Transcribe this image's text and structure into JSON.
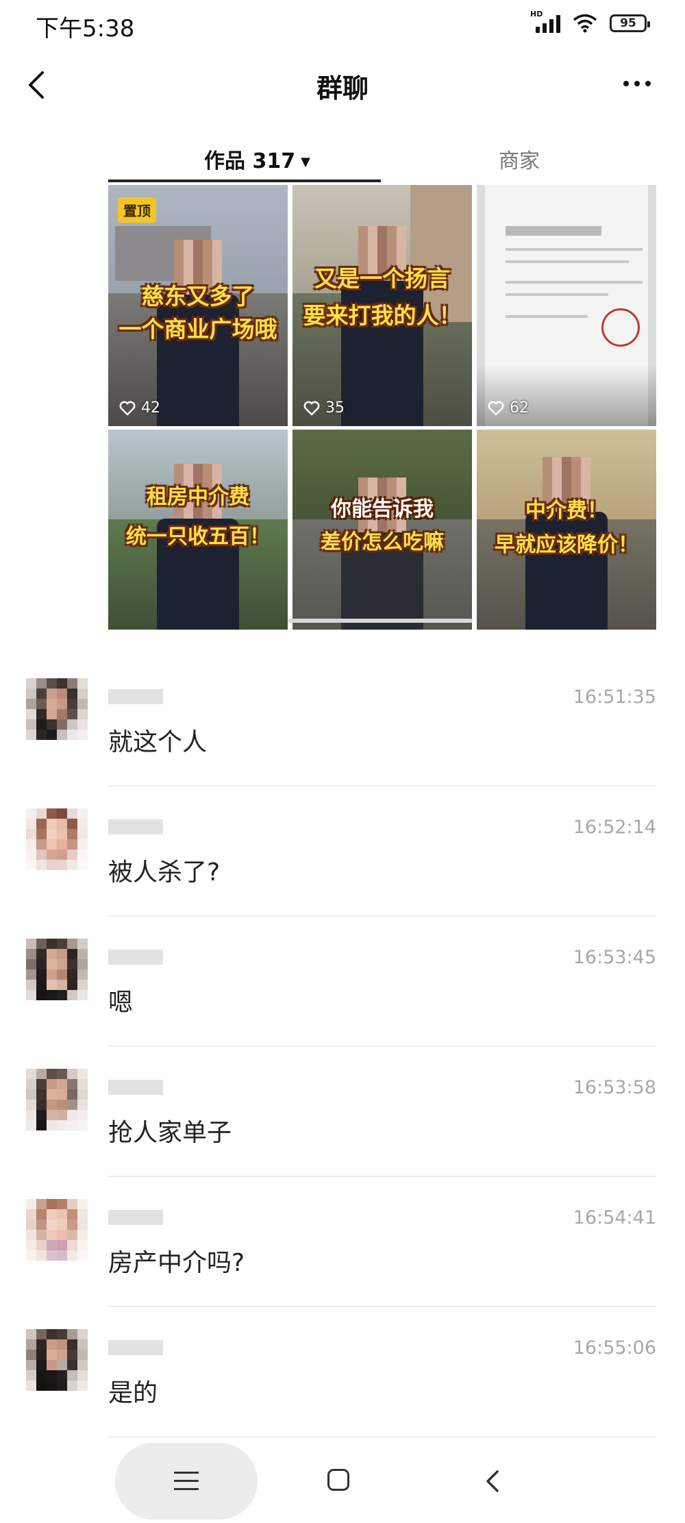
{
  "status": {
    "time": "下午5:38",
    "battery": "95",
    "signal_label": "HD"
  },
  "nav": {
    "title": "群聊"
  },
  "tabs": {
    "works": "作品 317",
    "merchant": "商家"
  },
  "videos": [
    {
      "pinned": "置顶",
      "caption_lines": [
        "慈东又多了",
        "一个商业广场哦"
      ],
      "likes": "42"
    },
    {
      "caption_lines": [
        "又是一个扬言",
        "要来打我的人！"
      ],
      "likes": "35"
    },
    {
      "likes": "62"
    },
    {
      "caption_lines": [
        "租房中介费",
        "统一只收五百！"
      ]
    },
    {
      "caption_lines": [
        "你能告诉我",
        "差价怎么吃嘛"
      ]
    },
    {
      "caption_lines": [
        "中介费！",
        "早就应该降价！"
      ]
    }
  ],
  "messages": [
    {
      "text": "就这个人",
      "time": "16:51:35"
    },
    {
      "text": "被人杀了?",
      "time": "16:52:14"
    },
    {
      "text": "嗯",
      "time": "16:53:45"
    },
    {
      "text": "抢人家单子",
      "time": "16:53:58"
    },
    {
      "text": "房产中介吗?",
      "time": "16:54:41"
    },
    {
      "text": "是的",
      "time": "16:55:06"
    }
  ],
  "colors": {
    "caption_yellow": "#ffe04a",
    "pinned_badge": "#f5c526",
    "time_gray": "#a8a8a8"
  },
  "icons": [
    "back-arrow-icon",
    "more-dots-icon",
    "heart-icon",
    "menu-icon",
    "home-icon",
    "back-icon"
  ]
}
